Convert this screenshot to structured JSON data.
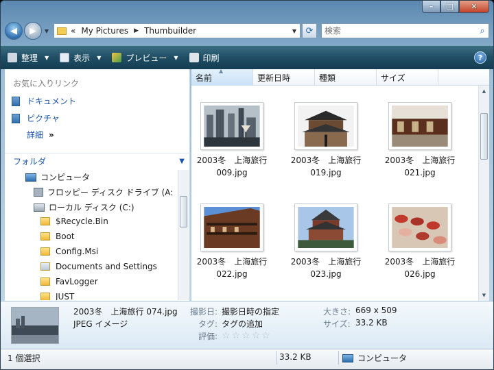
{
  "address": {
    "back_glyph": "◀",
    "forward_glyph": "▶",
    "overflow": "«",
    "segments": [
      "My Pictures",
      "Thumbuilder"
    ],
    "separator": "▶"
  },
  "search": {
    "placeholder": "検索"
  },
  "toolbar": {
    "organize": "整理",
    "views": "表示",
    "preview": "プレビュー",
    "print": "印刷",
    "help": "?"
  },
  "nav": {
    "favorites_header": "お気に入りリンク",
    "favorites": [
      "ドキュメント",
      "ピクチャ"
    ],
    "more": "詳細",
    "more_chevron": "»",
    "folders_header": "フォルダ",
    "tree": [
      {
        "label": "コンピュータ",
        "type": "pc"
      },
      {
        "label": "フロッピー ディスク ドライブ (A:",
        "type": "floppy"
      },
      {
        "label": "ローカル ディスク (C:)",
        "type": "disk"
      },
      {
        "label": "$Recycle.Bin",
        "type": "folder"
      },
      {
        "label": "Boot",
        "type": "folder"
      },
      {
        "label": "Config.Msi",
        "type": "folder"
      },
      {
        "label": "Documents and Settings",
        "type": "shortcut"
      },
      {
        "label": "FavLogger",
        "type": "folder"
      },
      {
        "label": "JUST",
        "type": "folder"
      }
    ]
  },
  "columns": [
    "名前",
    "更新日時",
    "種類",
    "サイズ"
  ],
  "files": [
    {
      "line1": "2003冬　上海旅行",
      "line2": "009.jpg"
    },
    {
      "line1": "2003冬　上海旅行",
      "line2": "019.jpg"
    },
    {
      "line1": "2003冬　上海旅行",
      "line2": "021.jpg"
    },
    {
      "line1": "2003冬　上海旅行",
      "line2": "022.jpg"
    },
    {
      "line1": "2003冬　上海旅行",
      "line2": "023.jpg"
    },
    {
      "line1": "2003冬　上海旅行",
      "line2": "026.jpg"
    }
  ],
  "details": {
    "filename": "2003冬　上海旅行 074.jpg",
    "filetype": "JPEG イメージ",
    "date_taken_label": "撮影日:",
    "date_taken_value": "撮影日時の指定",
    "tags_label": "タグ:",
    "tags_value": "タグの追加",
    "rating_label": "評価:",
    "rating_stars": 0,
    "dimensions_label": "大きさ:",
    "dimensions_value": "669 x 509",
    "size_label": "サイズ:",
    "size_value": "33.2 KB"
  },
  "status": {
    "selection": "1 個選択",
    "size": "33.2 KB",
    "location": "コンピュータ"
  }
}
